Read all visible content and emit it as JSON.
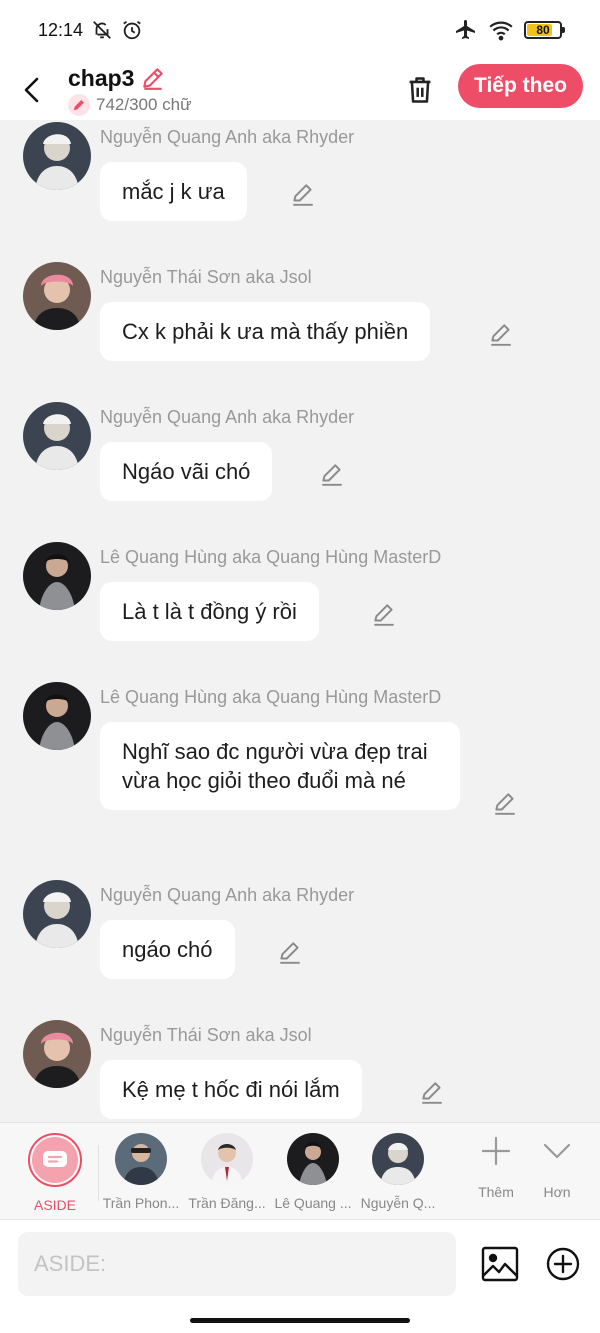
{
  "status": {
    "time": "12:14",
    "battery": "80",
    "battery_fraction": 0.8
  },
  "header": {
    "title": "chap3",
    "word_count": "742/300 chữ",
    "next_label": "Tiếp theo"
  },
  "messages": [
    {
      "sender": "Nguyễn Quang Anh aka Rhyder",
      "text": "mắc j k ưa"
    },
    {
      "sender": "Nguyễn Thái Sơn aka Jsol",
      "text": "Cx k phải k ưa mà thấy phiền"
    },
    {
      "sender": "Nguyễn Quang Anh aka Rhyder",
      "text": "Ngáo vãi chó"
    },
    {
      "sender": "Lê Quang Hùng aka Quang Hùng MasterD",
      "text": "Là t là t đồng ý rồi"
    },
    {
      "sender": "Lê Quang Hùng aka Quang Hùng MasterD",
      "text": "Nghĩ sao đc người vừa đẹp trai vừa học giỏi theo đuổi mà né"
    },
    {
      "sender": "Nguyễn Quang Anh aka Rhyder",
      "text": "ngáo chó"
    },
    {
      "sender": "Nguyễn Thái Sơn aka Jsol",
      "text": "Kệ mẹ t hốc đi nói lắm"
    }
  ],
  "characters": {
    "aside_label": "ASIDE",
    "items": [
      {
        "name": "Trần Phon..."
      },
      {
        "name": "Trần Đăng..."
      },
      {
        "name": "Lê Quang ..."
      },
      {
        "name": "Nguyễn Q..."
      }
    ],
    "more_label": "Thêm",
    "less_label": "Hơn"
  },
  "input": {
    "placeholder": "ASIDE:"
  },
  "colors": {
    "accent": "#ee4d68",
    "background": "#f2f2f2",
    "bubble": "#ffffff",
    "sender_text": "#999999"
  },
  "icons": {
    "back": "chevron-left-icon",
    "title_edit": "pencil-icon",
    "trash": "trash-icon",
    "image": "image-icon",
    "add": "plus-circle-icon"
  }
}
